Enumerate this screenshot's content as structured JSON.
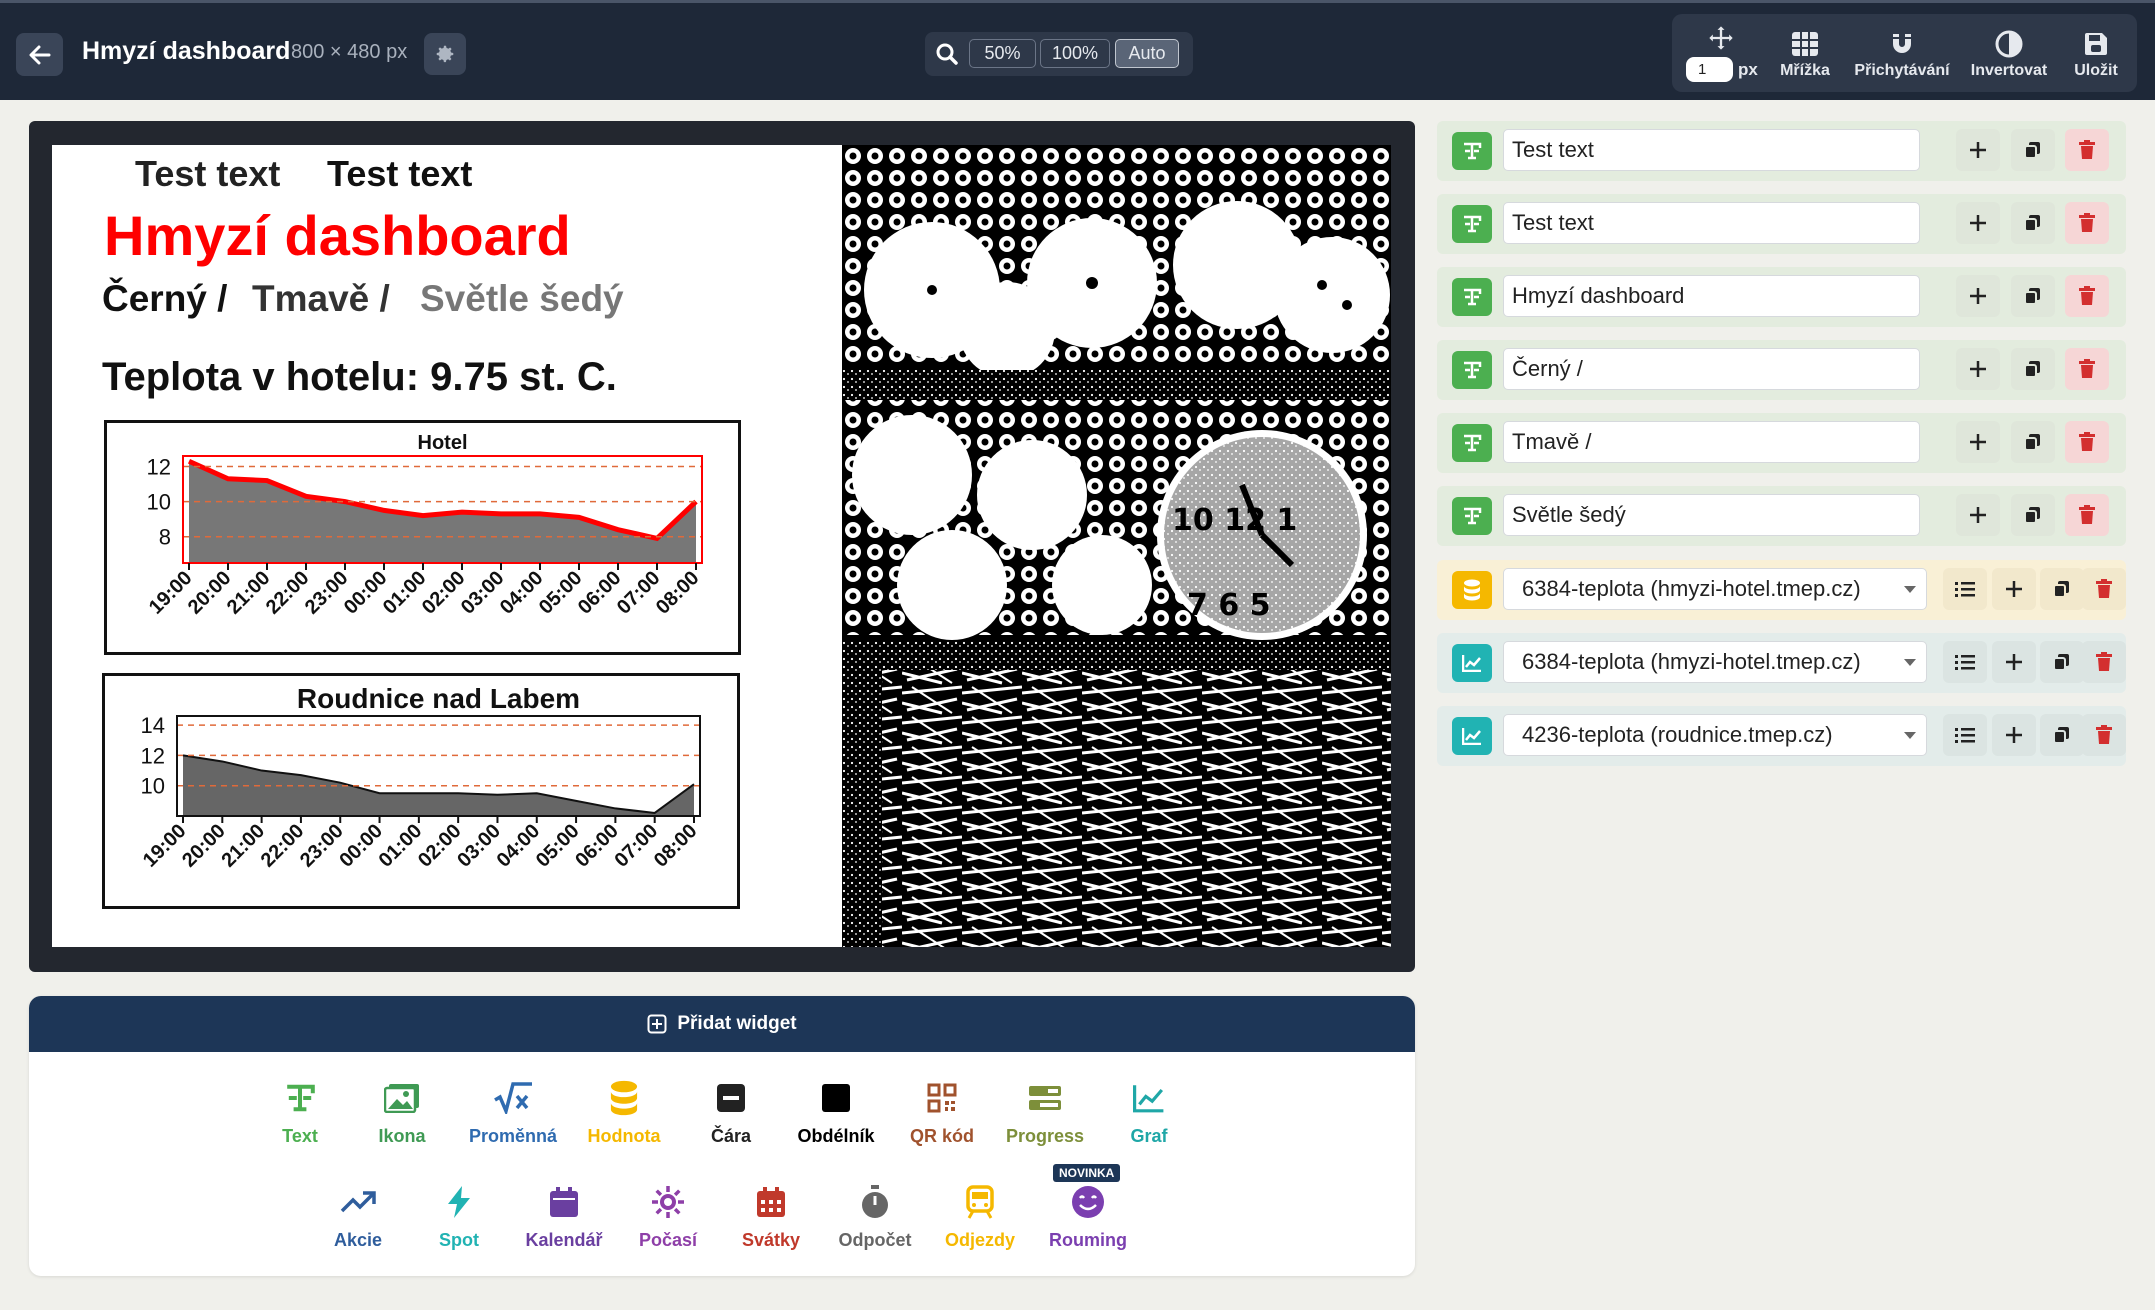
{
  "header": {
    "title": "Hmyzí dashboard",
    "size": "800 × 480 px",
    "zoom_options": [
      "50%",
      "100%",
      "Auto"
    ],
    "zoom_active": "Auto",
    "step_value": "1",
    "step_unit": "px",
    "tools": [
      "Mřížka",
      "Přichytávání",
      "Invertovat",
      "Uložit"
    ]
  },
  "canvas": {
    "test_text_1": "Test text",
    "test_text_2": "Test text",
    "headline": "Hmyzí dashboard",
    "shade_black": "Černý /",
    "shade_dark": "Tmavě /",
    "shade_light": "Světle šedý",
    "temperature": "Teplota v hotelu: 9.75 st. C."
  },
  "chart_data": [
    {
      "type": "area",
      "title": "Hotel",
      "x": [
        "19:00",
        "20:00",
        "21:00",
        "22:00",
        "23:00",
        "00:00",
        "01:00",
        "02:00",
        "03:00",
        "04:00",
        "05:00",
        "06:00",
        "07:00",
        "08:00"
      ],
      "values": [
        12.3,
        11.3,
        11.2,
        10.3,
        10.0,
        9.5,
        9.2,
        9.4,
        9.3,
        9.3,
        9.1,
        8.4,
        7.9,
        10.0
      ],
      "yticks": [
        8,
        10,
        12
      ],
      "ylim": [
        6.5,
        12.6
      ],
      "line_color": "#ff0000",
      "fill_color": "#777777"
    },
    {
      "type": "area",
      "title": "Roudnice nad Labem",
      "x": [
        "19:00",
        "20:00",
        "21:00",
        "22:00",
        "23:00",
        "00:00",
        "01:00",
        "02:00",
        "03:00",
        "04:00",
        "05:00",
        "06:00",
        "07:00",
        "08:00"
      ],
      "values": [
        12.0,
        11.6,
        11.0,
        10.7,
        10.2,
        9.5,
        9.5,
        9.5,
        9.4,
        9.5,
        9.0,
        8.5,
        8.2,
        10.1
      ],
      "yticks": [
        10,
        12,
        14
      ],
      "ylim": [
        8.0,
        14.6
      ],
      "line_color": "#111111",
      "fill_color": "#666666"
    }
  ],
  "layers": [
    {
      "type": "text",
      "value": "Test text"
    },
    {
      "type": "text",
      "value": "Test text"
    },
    {
      "type": "text",
      "value": "Hmyzí dashboard"
    },
    {
      "type": "text",
      "value": "Černý /"
    },
    {
      "type": "text",
      "value": "Tmavě /"
    },
    {
      "type": "text",
      "value": "Světle šedý"
    },
    {
      "type": "value",
      "value": "6384-teplota (hmyzi-hotel.tmep.cz)"
    },
    {
      "type": "chart",
      "value": "6384-teplota (hmyzi-hotel.tmep.cz)"
    },
    {
      "type": "chart",
      "value": "4236-teplota (roudnice.tmep.cz)"
    }
  ],
  "add_widget": {
    "title": "Přidat widget",
    "badge_new": "NOVINKA",
    "row1": [
      {
        "label": "Text",
        "icon": "text-icon",
        "color": "#4caf50"
      },
      {
        "label": "Ikona",
        "icon": "image-icon",
        "color": "#3f9a54"
      },
      {
        "label": "Proměnná",
        "icon": "square-root-icon",
        "color": "#2f6bb0"
      },
      {
        "label": "Hodnota",
        "icon": "database-icon",
        "color": "#f5b800"
      },
      {
        "label": "Čára",
        "icon": "minus-square-icon",
        "color": "#222222"
      },
      {
        "label": "Obdélník",
        "icon": "square-icon",
        "color": "#000000"
      },
      {
        "label": "QR kód",
        "icon": "qrcode-icon",
        "color": "#a0522d"
      },
      {
        "label": "Progress",
        "icon": "progress-icon",
        "color": "#7d8f3a"
      },
      {
        "label": "Graf",
        "icon": "chart-line-icon",
        "color": "#1fa7a7"
      }
    ],
    "row2": [
      {
        "label": "Akcie",
        "icon": "trend-icon",
        "color": "#2f5d9c"
      },
      {
        "label": "Spot",
        "icon": "bolt-icon",
        "color": "#21b3b3"
      },
      {
        "label": "Kalendář",
        "icon": "calendar-icon",
        "color": "#6a3fa0"
      },
      {
        "label": "Počasí",
        "icon": "sun-icon",
        "color": "#8e3fa8"
      },
      {
        "label": "Svátky",
        "icon": "calendar-grid-icon",
        "color": "#c0392b"
      },
      {
        "label": "Odpočet",
        "icon": "stopwatch-icon",
        "color": "#666666"
      },
      {
        "label": "Odjezdy",
        "icon": "train-icon",
        "color": "#f5b800"
      },
      {
        "label": "Rouming",
        "icon": "smile-icon",
        "color": "#7b3fb0"
      }
    ]
  }
}
